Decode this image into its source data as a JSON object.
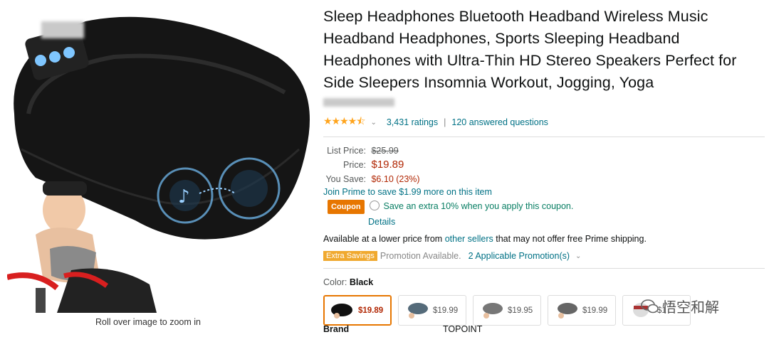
{
  "product": {
    "title": "Sleep Headphones Bluetooth Headband Wireless Music Headband Headphones, Sports Sleeping Headband Headphones with Ultra-Thin HD Stereo Speakers Perfect for Side Sleepers Insomnia Workout, Jogging, Yoga",
    "rating_value": 4.5,
    "stars": "★★★★⯪",
    "ratings_count": "3,431 ratings",
    "answered": "120 answered questions"
  },
  "image": {
    "roll_over_text": "Roll over image to zoom in"
  },
  "pricing": {
    "list_label": "List Price:",
    "list_price": "$25.99",
    "price_label": "Price:",
    "price": "$19.89",
    "save_label": "You Save:",
    "save_value": "$6.10 (23%)",
    "prime_text": "Join Prime to save $1.99 more on this item",
    "coupon_badge": "Coupon",
    "coupon_text": "Save an extra 10% when you apply this coupon.",
    "details_link": "Details"
  },
  "availability": {
    "prefix": "Available at a lower price from ",
    "link": "other sellers",
    "suffix": " that may not offer free Prime shipping."
  },
  "promotion": {
    "badge": "Extra Savings",
    "available": "Promotion Available.",
    "applicable": "2 Applicable Promotion(s)"
  },
  "color": {
    "label": "Color:",
    "selected": "Black",
    "options": [
      "$19.89",
      "$19.99",
      "$19.95",
      "$19.99",
      "$1"
    ]
  },
  "brand": {
    "label": "Brand",
    "value": "TOPOINT"
  },
  "watermark": "悟空和解",
  "colors": {
    "price_red": "#B12704",
    "link_teal": "#007185",
    "coupon_orange": "#e77600",
    "star_orange": "#FFA41C"
  }
}
